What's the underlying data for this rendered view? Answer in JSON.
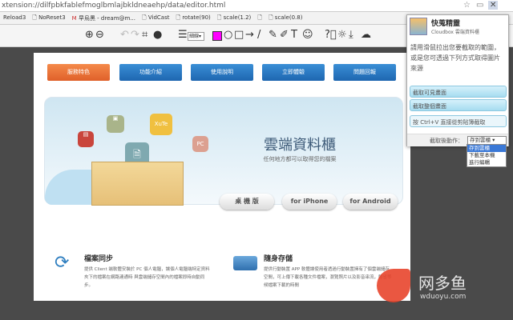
{
  "browser": {
    "url": "xtension://dilfpbkfablefmoglbmlajbkldneaehp/data/editor.html",
    "bookmarks": [
      "Reload3",
      "NoReset3",
      "早烏黑 - dream@m...",
      "VidCast",
      "rotate(90)",
      "scale(1.2)",
      "",
      "scale(0.8)"
    ]
  },
  "toolbar": {
    "line_style": "細線"
  },
  "page": {
    "nav": [
      "服務特色",
      "功能介紹",
      "使用說明",
      "立即體驗",
      "問題回報"
    ],
    "banner": {
      "title": "雲端資料櫃",
      "subtitle": "任何地方都可以取得您的檔案",
      "buttons": [
        "桌 機 版",
        "for iPhone",
        "for Android"
      ],
      "app_icon_xuite": "XuTe",
      "app_icon_pc": "PC"
    },
    "features": [
      {
        "title": "檔案同步",
        "desc": "提供 Client 端軟體安裝於 PC 個人電腦，讓個人電腦端特定資料夾下的檔案在網路連通時 與雲端儲存空間內的檔案即時自動同步。"
      },
      {
        "title": "隨身存儲",
        "desc": "提供行動裝置 APP 軟體讓使用者透過行動裝置擁有了個雲端儲存空間，可上傳下載各種文件檔案，瀏覽照片以及影音串流，節省等候檔案下載的時間"
      }
    ]
  },
  "popup": {
    "title": "快蒐精靈",
    "subtitle": "Cloudbox 雲端資料櫃",
    "instructions": "請用滑鼠拉出您要截取的範圍，或是您可透過下列方式取得圖片來源",
    "btn_visible": "截取可見畫面",
    "btn_full": "截取整個畫面",
    "btn_paste": "按 Ctrl+V 直接從剪貼簿截取",
    "after_label": "截取後動作：",
    "after_value": "存到雲櫃",
    "options": [
      "存到雲櫃",
      "下載至本機",
      "進行編輯"
    ]
  },
  "watermark": {
    "cn": "网多鱼",
    "url": "wduoyu.com"
  }
}
